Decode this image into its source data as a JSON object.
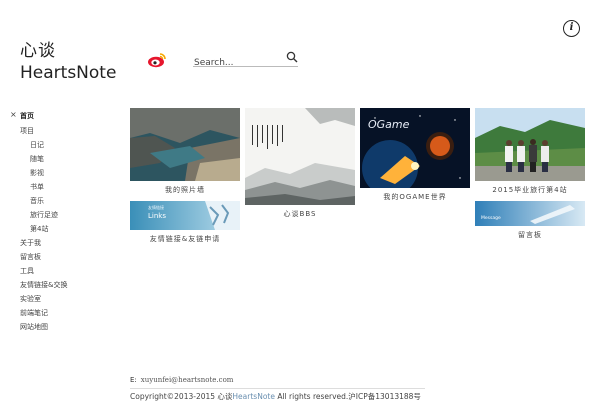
{
  "site": {
    "title_cn": "心谈",
    "title_en": "HeartsNote"
  },
  "search": {
    "placeholder": "Search..."
  },
  "nav": {
    "close_label": "×",
    "items": [
      "首页",
      "项目",
      "日记",
      "随笔",
      "影视",
      "书单",
      "音乐",
      "旅行足迹",
      "第4站",
      "关于我",
      "留言板",
      "工具",
      "友情链接&交换",
      "实验室",
      "前端笔记",
      "网站地图"
    ]
  },
  "gallery": [
    {
      "caption": "我的照片墙"
    },
    {
      "caption": "心谈BBS"
    },
    {
      "caption": "我的OGAME世界"
    },
    {
      "caption": "2015毕业旅行第4站"
    },
    {
      "caption": "友情链接&友链申请",
      "image_text": "Links",
      "image_subtext": "友情链接"
    },
    {
      "caption": "留言板",
      "image_text": "Message"
    }
  ],
  "tile_texts": {
    "ogame": "OGame"
  },
  "footer": {
    "email_label": "E:",
    "email": "xuyunfei@heartsnote.com",
    "copyright_prefix": "Copyright©2013-2015 心谈",
    "copyright_link": "HeartsNote",
    "copyright_suffix": " All rights reserved.沪ICP备13013188号"
  },
  "colors": {
    "accent_link": "#6a8fb0",
    "weibo_red": "#e6162d",
    "weibo_yellow": "#f7a700"
  }
}
